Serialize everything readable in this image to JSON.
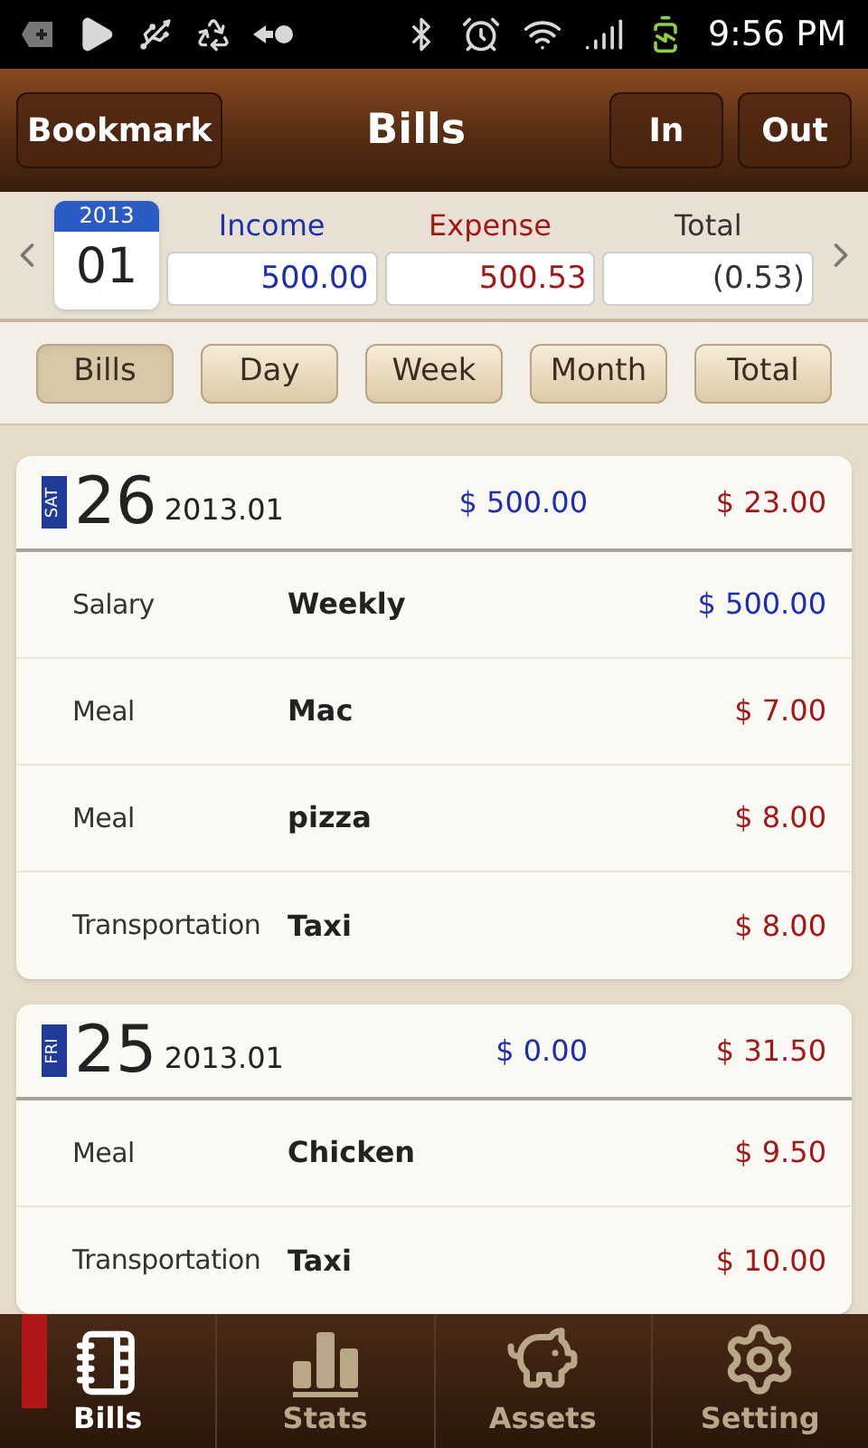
{
  "status_bar": {
    "time": "9:56 PM"
  },
  "header": {
    "bookmark": "Bookmark",
    "title": "Bills",
    "buttons": [
      "In",
      "Out"
    ]
  },
  "summary": {
    "year": "2013",
    "month": "01",
    "income_label": "Income",
    "income": "500.00",
    "expense_label": "Expense",
    "expense": "500.53",
    "total_label": "Total",
    "total": "(0.53)"
  },
  "filters": [
    {
      "label": "Bills",
      "selected": true
    },
    {
      "label": "Day",
      "selected": false
    },
    {
      "label": "Week",
      "selected": false
    },
    {
      "label": "Month",
      "selected": false
    },
    {
      "label": "Total",
      "selected": false
    }
  ],
  "days": [
    {
      "weekday": "SAT",
      "day": "26",
      "month": "2013.01",
      "income": "$ 500.00",
      "expense": "$ 23.00",
      "entries": [
        {
          "category": "Salary",
          "name": "Weekly",
          "amount": "$ 500.00",
          "kind": "income"
        },
        {
          "category": "Meal",
          "name": "Mac",
          "amount": "$ 7.00",
          "kind": "expense"
        },
        {
          "category": "Meal",
          "name": "pizza",
          "amount": "$ 8.00",
          "kind": "expense"
        },
        {
          "category": "Transportation",
          "name": "Taxi",
          "amount": "$ 8.00",
          "kind": "expense"
        }
      ]
    },
    {
      "weekday": "FRI",
      "day": "25",
      "month": "2013.01",
      "income": "$ 0.00",
      "expense": "$ 31.50",
      "entries": [
        {
          "category": "Meal",
          "name": "Chicken",
          "amount": "$ 9.50",
          "kind": "expense"
        },
        {
          "category": "Transportation",
          "name": "Taxi",
          "amount": "$ 10.00",
          "kind": "expense"
        }
      ]
    }
  ],
  "nav": [
    {
      "label": "Bills",
      "kind": "notebook",
      "selected": true
    },
    {
      "label": "Stats",
      "kind": "bars",
      "selected": false
    },
    {
      "label": "Assets",
      "kind": "piggy",
      "selected": false
    },
    {
      "label": "Setting",
      "kind": "gear",
      "selected": false
    }
  ]
}
